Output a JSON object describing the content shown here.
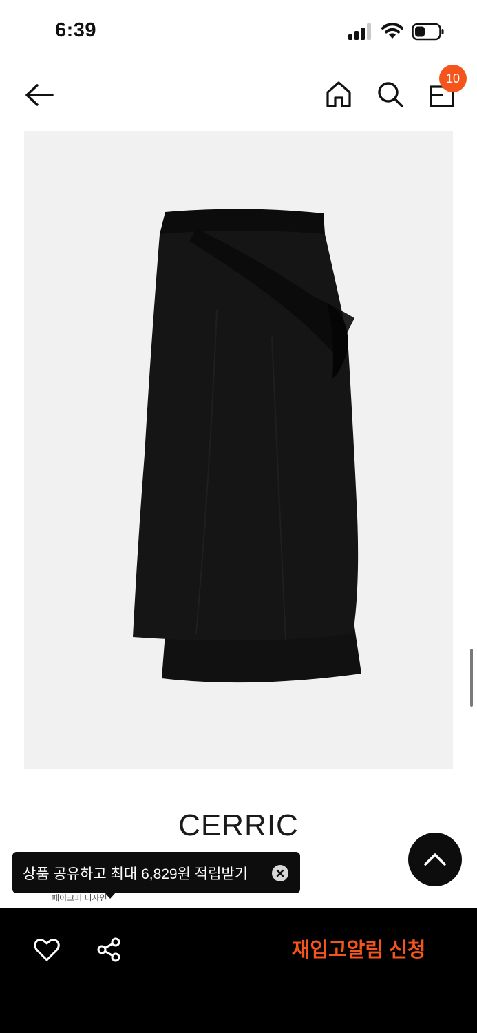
{
  "status_bar": {
    "time": "6:39"
  },
  "nav": {
    "back_icon": "arrow-left-icon",
    "home_icon": "home-icon",
    "search_icon": "search-icon",
    "cart_icon": "shopping-bag-icon",
    "cart_count": "10",
    "badge_color": "#f5541c"
  },
  "product": {
    "image_description_icon": "product-photo",
    "brand": "CERRIC"
  },
  "tooltip": {
    "text": "상품 공유하고 최대 6,829원 적립받기",
    "close_icon": "close-circle-icon",
    "partial_text": "페이크퍼 디자인"
  },
  "bottom_bar": {
    "wishlist_icon": "heart-icon",
    "share_icon": "share-icon",
    "restock_label": "재입고알림 신청",
    "accent_color": "#f5541c"
  },
  "scroll_top_icon": "chevron-up-icon"
}
